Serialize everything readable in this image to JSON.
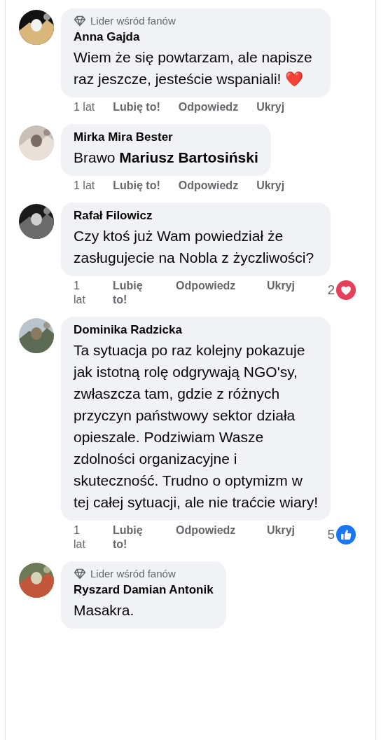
{
  "comments": [
    {
      "badge": "Lider wśród fanów",
      "author": "Anna Gajda",
      "text": "Wiem że się powtarzam, ale napisze raz jeszcze, jesteście wspaniali! ❤️",
      "actions": {
        "time": "1 lat",
        "like": "Lubię to!",
        "reply": "Odpowiedz",
        "hide": "Ukryj"
      }
    },
    {
      "author": "Mirka Mira Bester",
      "text": "Brawo **Mariusz Bartosiński**",
      "actions": {
        "time": "1 lat",
        "like": "Lubię to!",
        "reply": "Odpowiedz",
        "hide": "Ukryj"
      }
    },
    {
      "author": "Rafał Filowicz",
      "text": "Czy ktoś już Wam powiedział że zasługujecie na Nobla z życzliwości?",
      "actions": {
        "time": "1 lat",
        "like": "Lubię to!",
        "reply": "Odpowiedz",
        "hide": "Ukryj"
      },
      "reaction": {
        "kind": "heart",
        "count": "2"
      }
    },
    {
      "author": "Dominika Radzicka",
      "text": "Ta sytuacja po raz kolejny pokazuje jak istotną rolę odgrywają NGO'sy, zwłaszcza tam, gdzie z różnych przyczyn państwowy sektor działa opieszale. Podziwiam Wasze zdolności organizacyjne i skuteczność. Trudno o optymizm w tej całej sytuacji, ale nie traćcie wiary!",
      "actions": {
        "time": "1 lat",
        "like": "Lubię to!",
        "reply": "Odpowiedz",
        "hide": "Ukryj"
      },
      "reaction": {
        "kind": "like",
        "count": "5"
      }
    },
    {
      "badge": "Lider wśród fanów",
      "author": "Ryszard Damian Antonik",
      "text": "Masakra."
    }
  ]
}
